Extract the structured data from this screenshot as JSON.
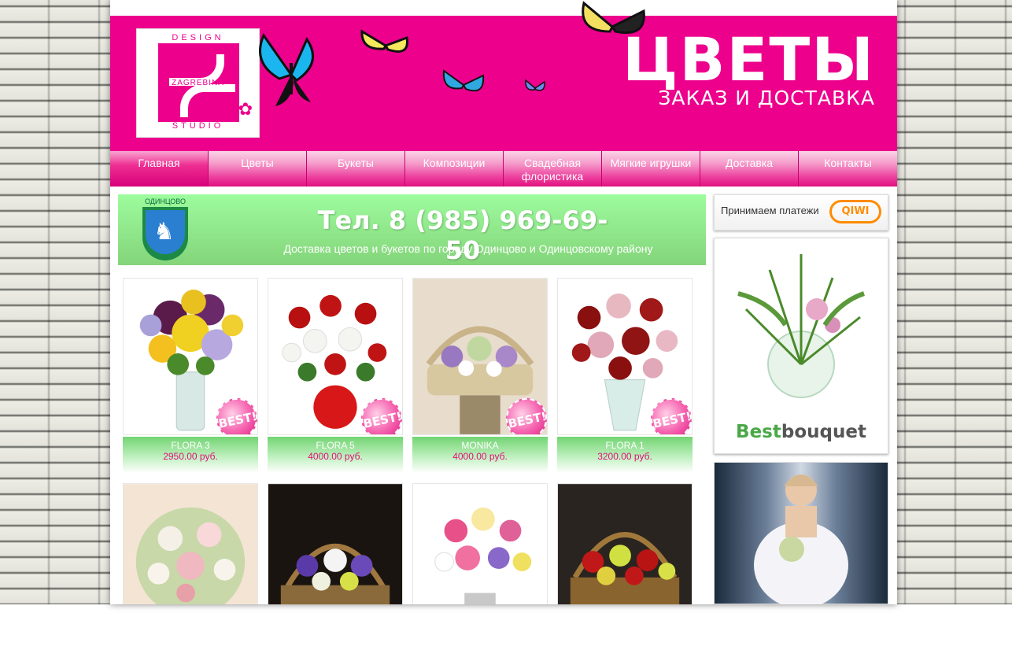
{
  "header": {
    "logo": {
      "top_text": "DESIGN",
      "middle_text": "ZAGREBINA",
      "bottom_text": "STUDIO"
    },
    "title": "ЦВЕТЫ",
    "subtitle": "ЗАКАЗ И ДОСТАВКА"
  },
  "nav": {
    "items": [
      {
        "label": "Главная"
      },
      {
        "label": "Цветы"
      },
      {
        "label": "Букеты"
      },
      {
        "label": "Композиции"
      },
      {
        "label": "Свадебная флористика"
      },
      {
        "label": "Мягкие игрушки"
      },
      {
        "label": "Доставка"
      },
      {
        "label": "Контакты"
      }
    ]
  },
  "banner": {
    "coat_of_arms_label": "ОДИНЦОВО",
    "phone": "Тел. 8 (985) 969-69-50",
    "text": "Доставка цветов и букетов по городу Одинцово и Одинцовскому району"
  },
  "products": [
    {
      "name": "FLORA 3",
      "price": "2950.00 руб.",
      "badge": "BEST!"
    },
    {
      "name": "FLORA 5",
      "price": "4000.00 руб.",
      "badge": "BEST!"
    },
    {
      "name": "MONIKA",
      "price": "4000.00 руб.",
      "badge": "BEST!"
    },
    {
      "name": "FLORA 1",
      "price": "3200.00 руб.",
      "badge": "BEST!"
    }
  ],
  "sidebar": {
    "payments_text": "Принимаем платежи",
    "qiwi_logo": "QIWI",
    "ad_brand_1": "Best",
    "ad_brand_2": "bouquet"
  },
  "colors": {
    "brand_pink": "#ec008c",
    "banner_green": "#84d47a",
    "price_pink": "#e0107a"
  }
}
